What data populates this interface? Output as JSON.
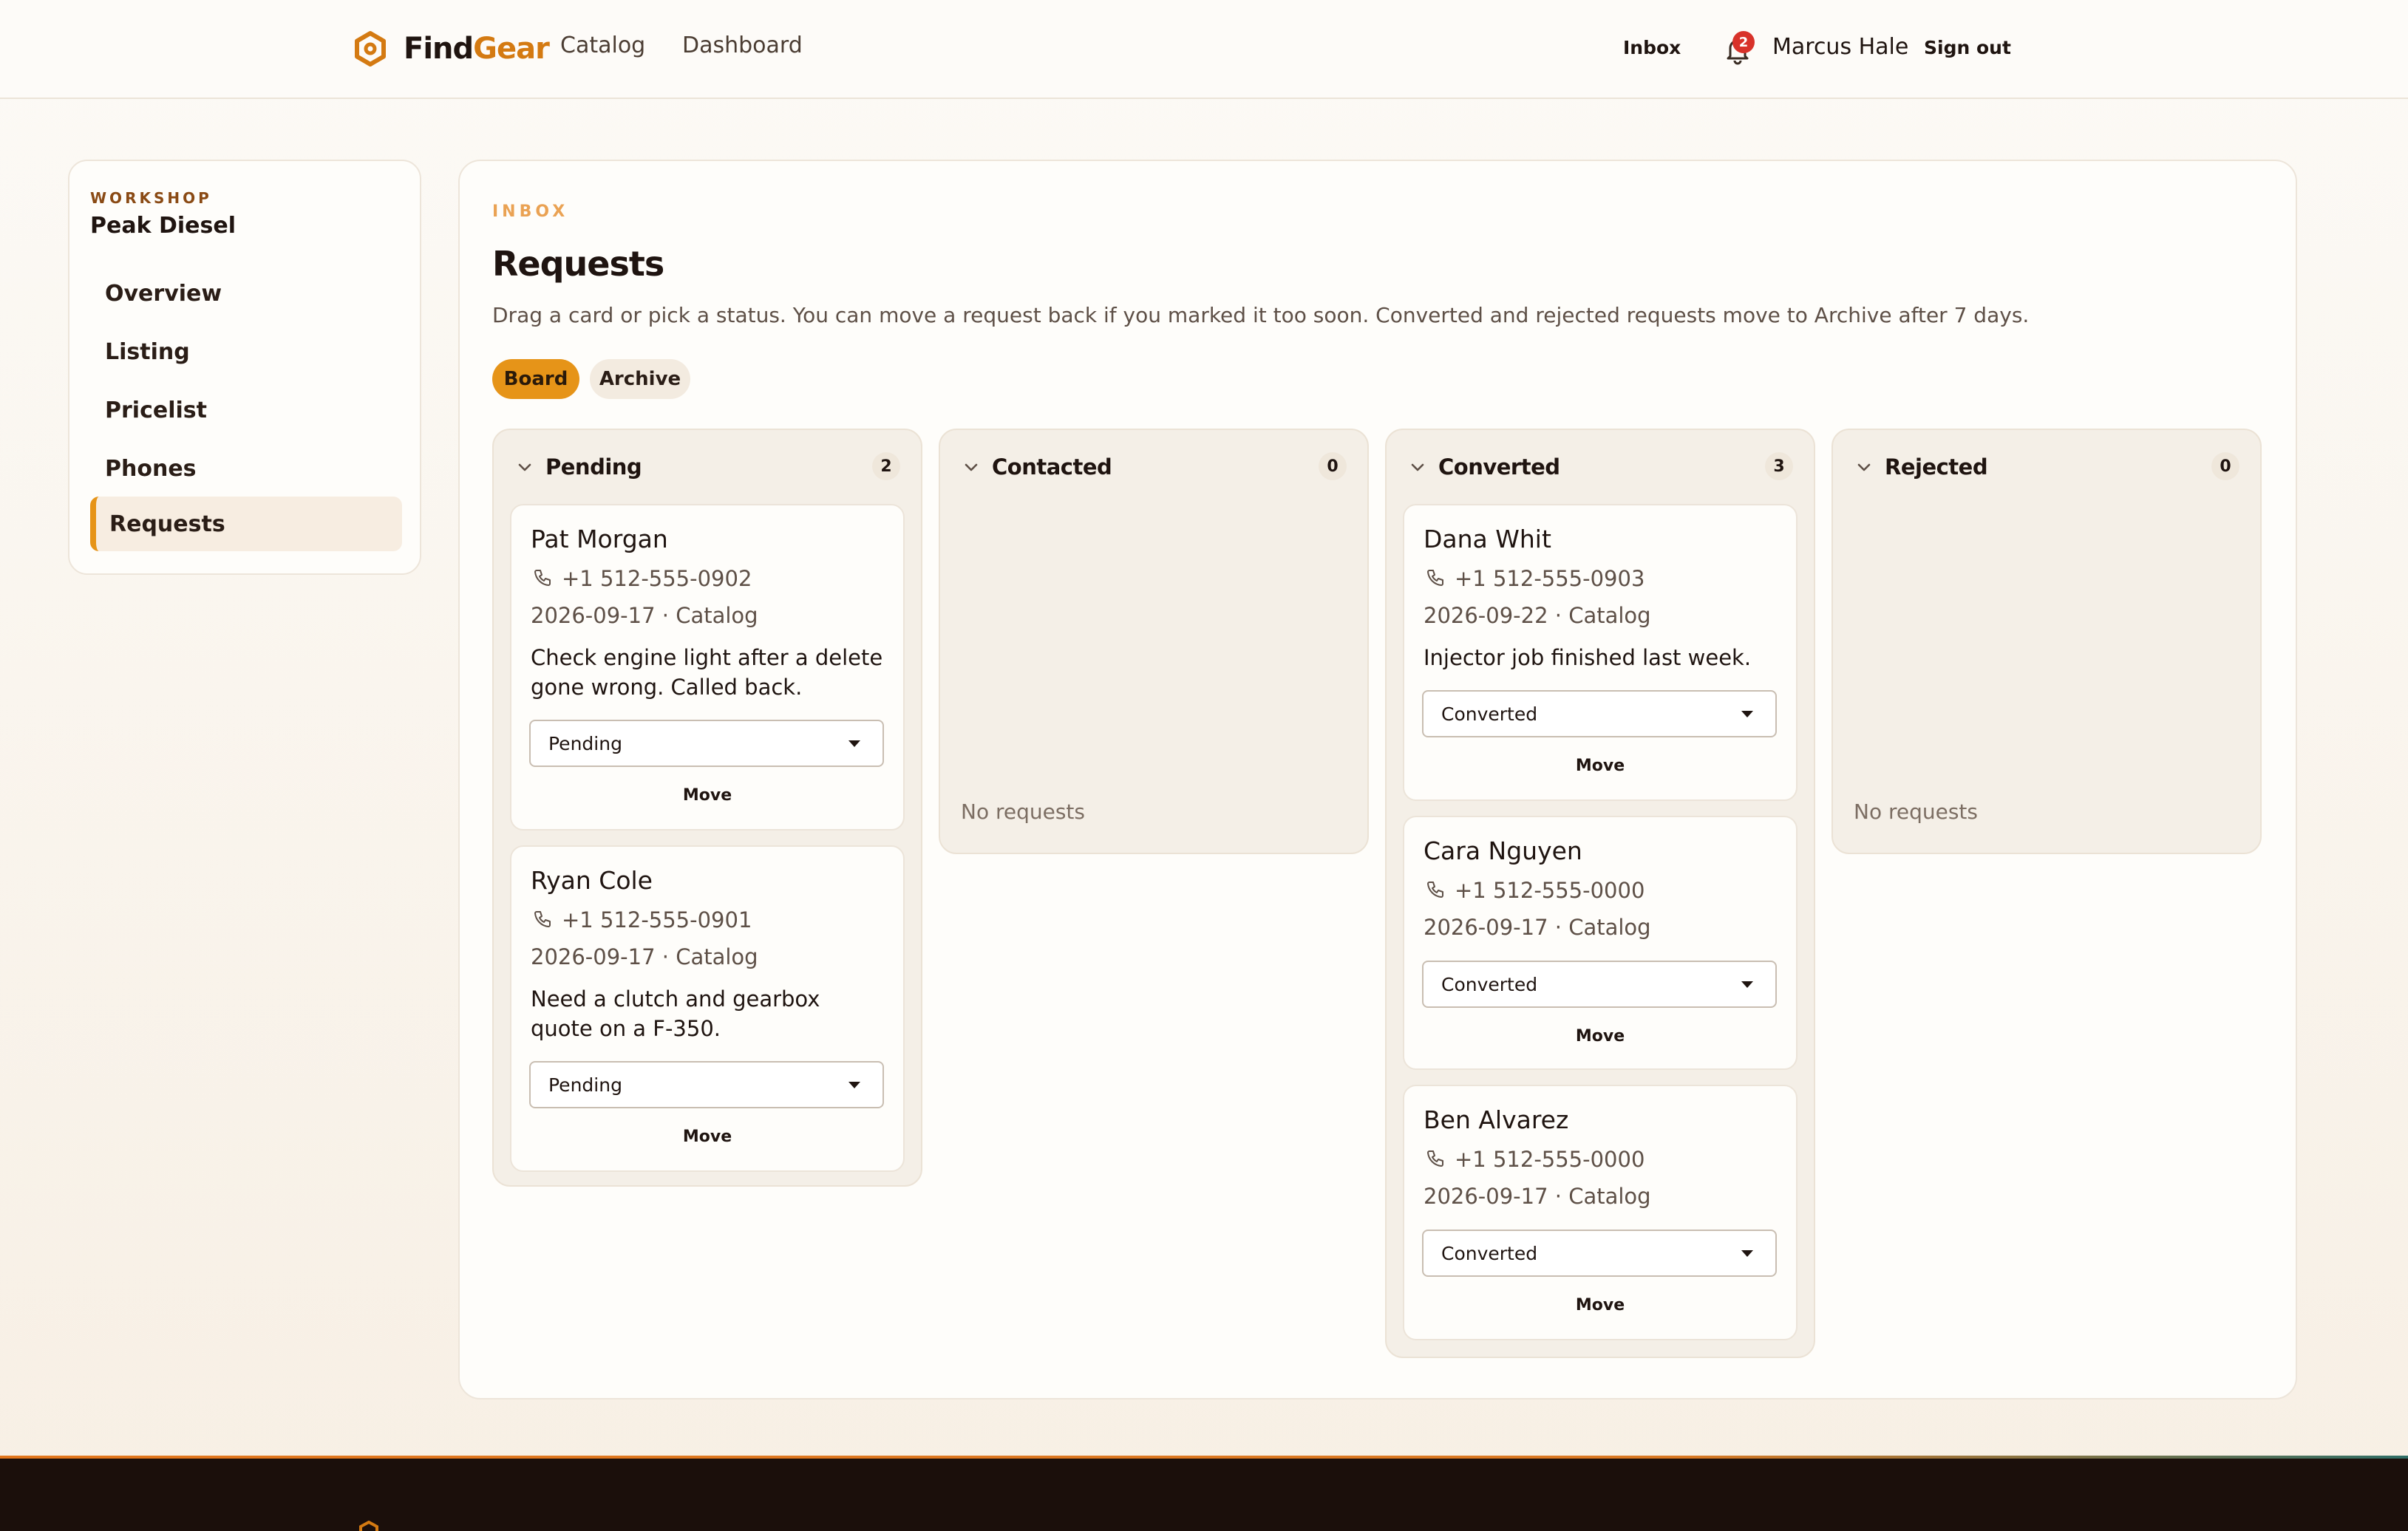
{
  "header": {
    "brand_find": "Find",
    "brand_gear": "Gear",
    "nav": [
      "Catalog",
      "Dashboard"
    ],
    "inbox_label": "Inbox",
    "notification_count": "2",
    "user_name": "Marcus Hale",
    "signout_label": "Sign out"
  },
  "sidebar": {
    "kicker": "WORKSHOP",
    "title": "Peak Diesel",
    "items": [
      {
        "label": "Overview",
        "active": false
      },
      {
        "label": "Listing",
        "active": false
      },
      {
        "label": "Pricelist",
        "active": false
      },
      {
        "label": "Phones",
        "active": false
      },
      {
        "label": "Requests",
        "active": true
      }
    ]
  },
  "main": {
    "kicker": "INBOX",
    "title": "Requests",
    "description": "Drag a card or pick a status. You can move a request back if you marked it too soon. Converted and rejected requests move to Archive after 7 days.",
    "tabs": [
      {
        "label": "Board",
        "active": true
      },
      {
        "label": "Archive",
        "active": false
      }
    ],
    "move_label": "Move",
    "empty_label": "No requests",
    "columns": [
      {
        "title": "Pending",
        "count": "2",
        "cards": [
          {
            "name": "Pat Morgan",
            "phone": "+1 512-555-0902",
            "meta": "2026-09-17 · Catalog",
            "note": "Check engine light after a delete gone wrong. Called back.",
            "status": "Pending"
          },
          {
            "name": "Ryan Cole",
            "phone": "+1 512-555-0901",
            "meta": "2026-09-17 · Catalog",
            "note": "Need a clutch and gearbox quote on a F-350.",
            "status": "Pending"
          }
        ]
      },
      {
        "title": "Contacted",
        "count": "0",
        "cards": []
      },
      {
        "title": "Converted",
        "count": "3",
        "cards": [
          {
            "name": "Dana Whit",
            "phone": "+1 512-555-0903",
            "meta": "2026-09-22 · Catalog",
            "note": "Injector job finished last week.",
            "status": "Converted"
          },
          {
            "name": "Cara Nguyen",
            "phone": "+1 512-555-0000",
            "meta": "2026-09-17 · Catalog",
            "note": "",
            "status": "Converted"
          },
          {
            "name": "Ben Alvarez",
            "phone": "+1 512-555-0000",
            "meta": "2026-09-17 · Catalog",
            "note": "",
            "status": "Converted"
          }
        ]
      },
      {
        "title": "Rejected",
        "count": "0",
        "cards": []
      }
    ]
  },
  "colors": {
    "accent": "#e69418",
    "brand_gear": "#d47a12",
    "badge": "#d8322a",
    "footer": "#1b0f0b"
  },
  "icons": [
    "hexagon-logo-icon",
    "bell-icon",
    "chevron-down-icon",
    "phone-icon",
    "caret-down-icon"
  ]
}
